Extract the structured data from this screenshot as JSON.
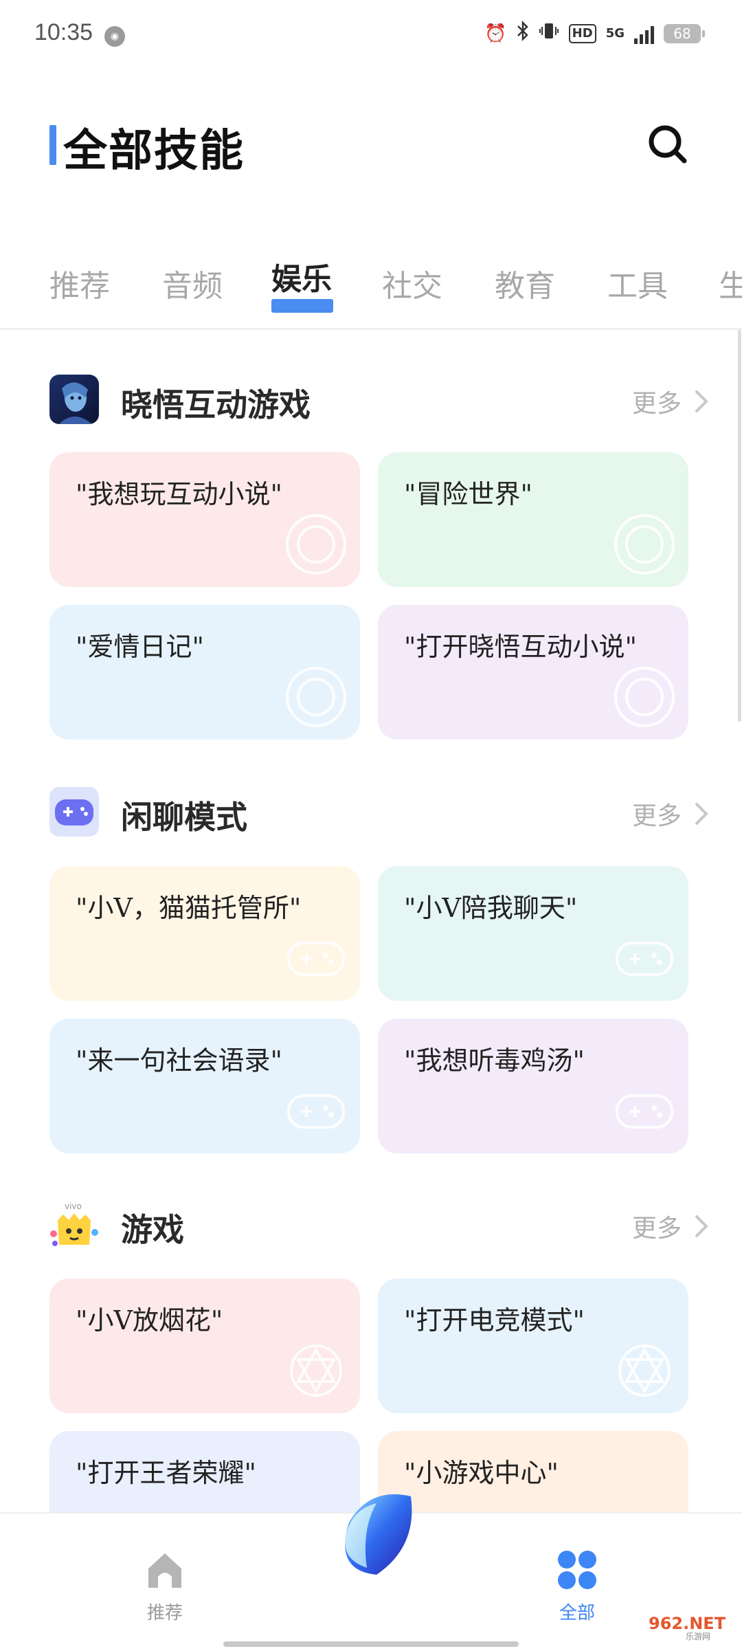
{
  "status_bar": {
    "time": "10:35",
    "hd": "HD",
    "network": "5G",
    "battery": "68"
  },
  "header": {
    "title": "全部技能"
  },
  "tabs": [
    {
      "label": "推荐"
    },
    {
      "label": "音频"
    },
    {
      "label": "娱乐"
    },
    {
      "label": "社交"
    },
    {
      "label": "教育"
    },
    {
      "label": "工具"
    },
    {
      "label": "生"
    }
  ],
  "more_label": "更多",
  "sections": [
    {
      "title": "晓悟互动游戏",
      "cards": [
        {
          "text": "\"我想玩互动小说\""
        },
        {
          "text": "\"冒险世界\""
        },
        {
          "text": "\"爱情日记\""
        },
        {
          "text": "\"打开晓悟互动小说\""
        }
      ]
    },
    {
      "title": "闲聊模式",
      "cards": [
        {
          "text": "\"小V，猫猫托管所\""
        },
        {
          "text": "\"小V陪我聊天\""
        },
        {
          "text": "\"来一句社会语录\""
        },
        {
          "text": "\"我想听毒鸡汤\""
        }
      ]
    },
    {
      "title": "游戏",
      "icon_badge": "vivo",
      "cards": [
        {
          "text": "\"小V放烟花\""
        },
        {
          "text": "\"打开电竞模式\""
        },
        {
          "text": "\"打开王者荣耀\""
        },
        {
          "text": "\"小游戏中心\""
        }
      ]
    }
  ],
  "bottom_nav": {
    "recommend": "推荐",
    "all": "全部"
  },
  "watermark": {
    "brand": "962.NET",
    "sub": "乐游网"
  },
  "colors": {
    "accent": "#4a8cf0",
    "card_pink": "#fde9e9",
    "card_green": "#e6f7ec",
    "card_blue": "#e6f3fd",
    "card_purple": "#f3ebfa",
    "card_yellow": "#fff6e6",
    "card_teal": "#e6f6f4",
    "card_periwinkle": "#e9effc",
    "card_orange": "#fff0e3"
  }
}
